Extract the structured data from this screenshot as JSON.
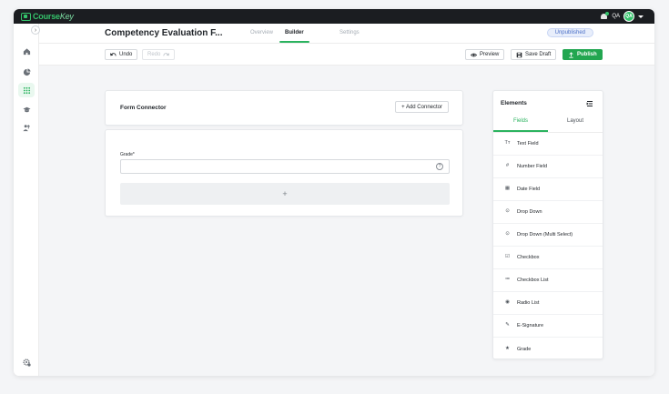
{
  "app": {
    "logo_text_main": "Course",
    "logo_text_accent": "Key",
    "user_initials": "QA",
    "avatar_label": "QA"
  },
  "header": {
    "title": "Competency Evaluation F...",
    "tabs": [
      {
        "label": "Overview",
        "active": false
      },
      {
        "label": "Builder",
        "active": true
      },
      {
        "label": "Settings",
        "active": false
      }
    ],
    "status": "Unpublished"
  },
  "toolbar": {
    "undo_label": "Undo",
    "redo_label": "Redo",
    "preview_label": "Preview",
    "save_draft_label": "Save Draft",
    "publish_label": "Publish"
  },
  "form_connector": {
    "title": "Form Connector",
    "add_label": "+ Add Connector"
  },
  "form": {
    "field_label": "Grade",
    "required_mark": "*",
    "field_value": "",
    "add_row_symbol": "+"
  },
  "elements_panel": {
    "title": "Elements",
    "tabs": [
      {
        "label": "Fields",
        "active": true
      },
      {
        "label": "Layout",
        "active": false
      }
    ],
    "items": [
      {
        "icon": "Tт",
        "icon_name": "text-field-icon",
        "label": "Text Field"
      },
      {
        "icon": "#",
        "icon_name": "number-field-icon",
        "label": "Number Field"
      },
      {
        "icon": "▦",
        "icon_name": "calendar-icon",
        "label": "Date Field"
      },
      {
        "icon": "⊙",
        "icon_name": "dropdown-icon",
        "label": "Drop Down"
      },
      {
        "icon": "⊙",
        "icon_name": "dropdown-multi-icon",
        "label": "Drop Down (Multi Select)"
      },
      {
        "icon": "☑",
        "icon_name": "checkbox-icon",
        "label": "Checkbox"
      },
      {
        "icon": "≔",
        "icon_name": "checkbox-list-icon",
        "label": "Checkbox List"
      },
      {
        "icon": "◉",
        "icon_name": "radio-list-icon",
        "label": "Radio List"
      },
      {
        "icon": "✎",
        "icon_name": "signature-icon",
        "label": "E-Signature"
      },
      {
        "icon": "★",
        "icon_name": "grade-icon",
        "label": "Grade"
      }
    ]
  },
  "colors": {
    "brand": "#2bb35f",
    "topbar": "#1b1d21",
    "status_badge_text": "#4a6fc7"
  }
}
